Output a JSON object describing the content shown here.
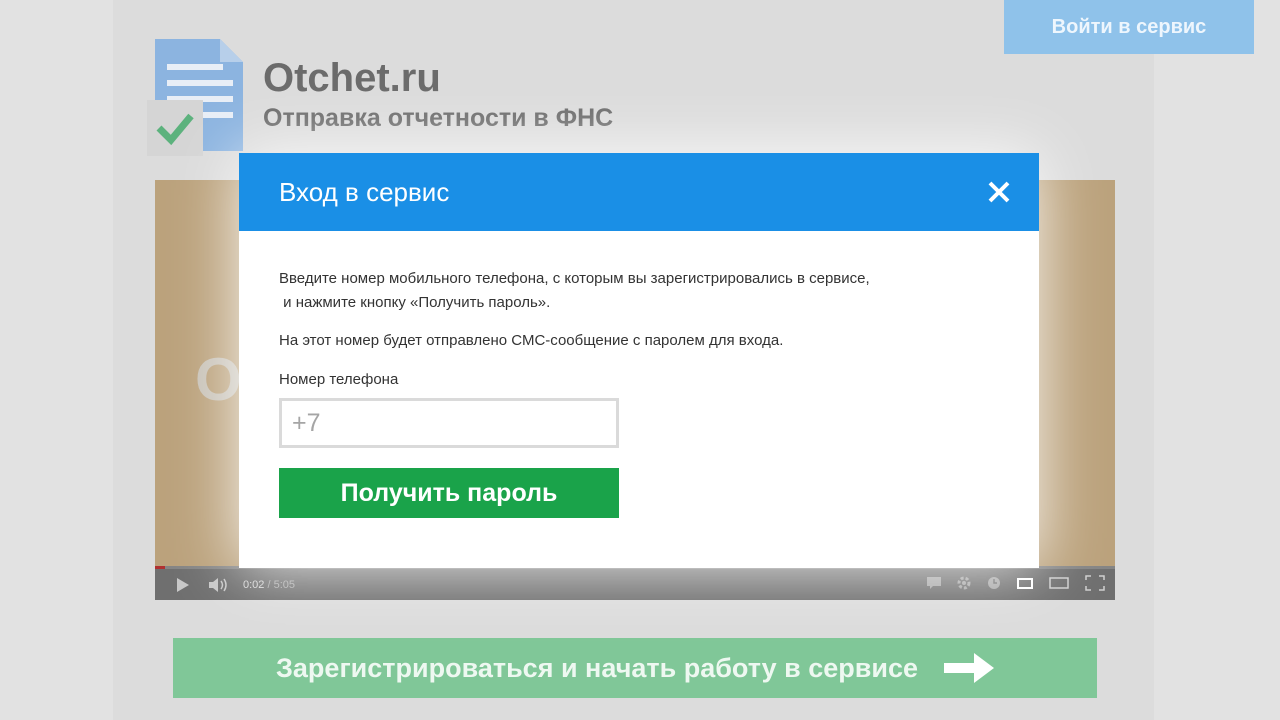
{
  "header": {
    "login_button": "Войти в сервис",
    "brand_title": "Otchet.ru",
    "brand_subtitle": "Отправка отчетности в ФНС"
  },
  "video": {
    "ghost_text": "О",
    "current_time": "0:02",
    "total_time": " / 5:05",
    "progress": 0.01
  },
  "register": {
    "label": "Зарегистрироваться и начать работу в сервисе"
  },
  "modal": {
    "title": "Вход в сервис",
    "instruction_line1": "Введите номер мобильного телефона, с которым вы зарегистрировались в сервисе,",
    "instruction_line2": " и нажмите кнопку «Получить пароль».",
    "sms_note": "На этот номер будет отправлено СМС-сообщение с паролем для входа.",
    "phone_label": "Номер телефона",
    "phone_placeholder": "+7",
    "submit_label": "Получить пароль"
  },
  "colors": {
    "modal_header": "#1a8fe6",
    "submit_green": "#1aa34a",
    "login_button": "#8fc2ea",
    "register_bar": "#80c798"
  }
}
